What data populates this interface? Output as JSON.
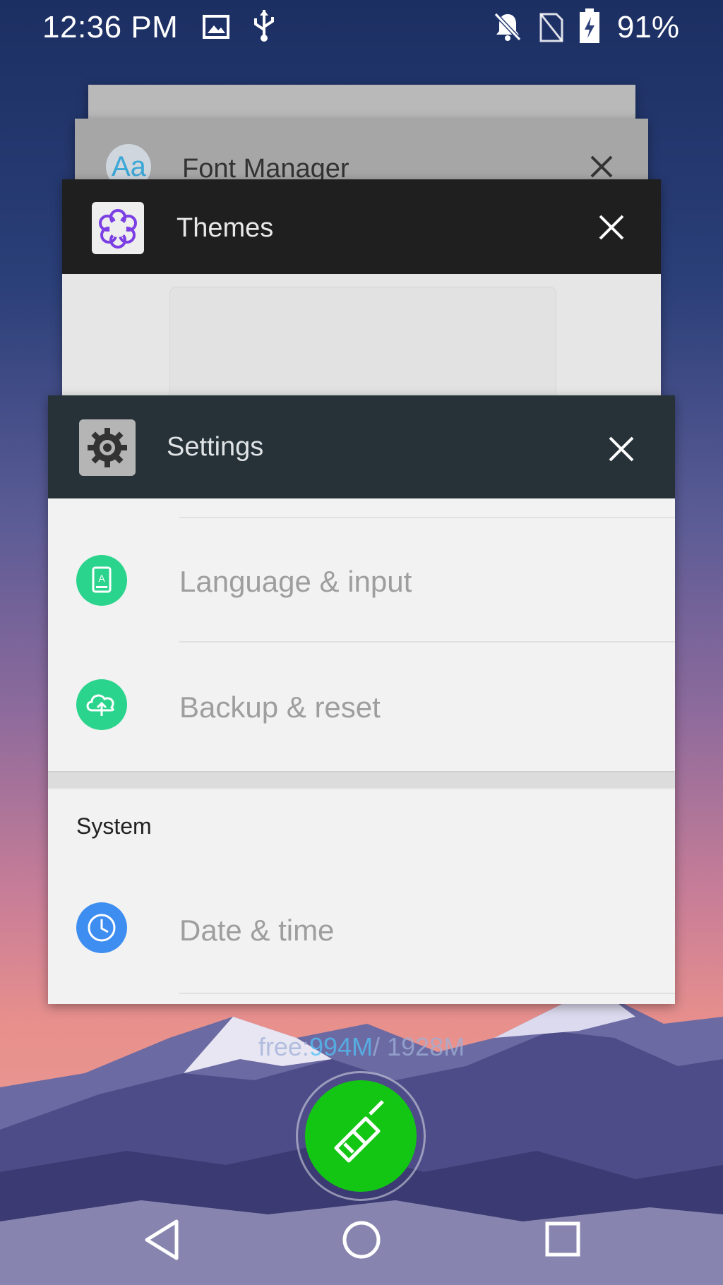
{
  "status_bar": {
    "time": "12:36 PM",
    "battery": "91%",
    "icons": [
      "image-icon",
      "usb-icon",
      "notifications-off-icon",
      "no-sim-icon",
      "battery-charging-icon"
    ]
  },
  "recents": {
    "cards": [
      {
        "app": "Font Manager",
        "icon": "font-aa-icon"
      },
      {
        "app": "Themes",
        "icon": "themes-flower-icon"
      },
      {
        "app": "Settings",
        "icon": "settings-gear-icon"
      }
    ]
  },
  "settings_preview": {
    "items": [
      {
        "label": "Language & input",
        "icon": "language-icon",
        "color": "#2bd48c"
      },
      {
        "label": "Backup & reset",
        "icon": "backup-cloud-icon",
        "color": "#2bd48c"
      }
    ],
    "section": "System",
    "system_items": [
      {
        "label": "Date & time",
        "icon": "clock-icon",
        "color": "#3d8ef0"
      }
    ]
  },
  "memory": {
    "prefix": "free:",
    "free": "994M",
    "sep": "/ ",
    "total": "1928M"
  },
  "colors": {
    "clean_button": "#14c614",
    "settings_bar": "#263238",
    "themes_bar": "#1f1f1f"
  }
}
